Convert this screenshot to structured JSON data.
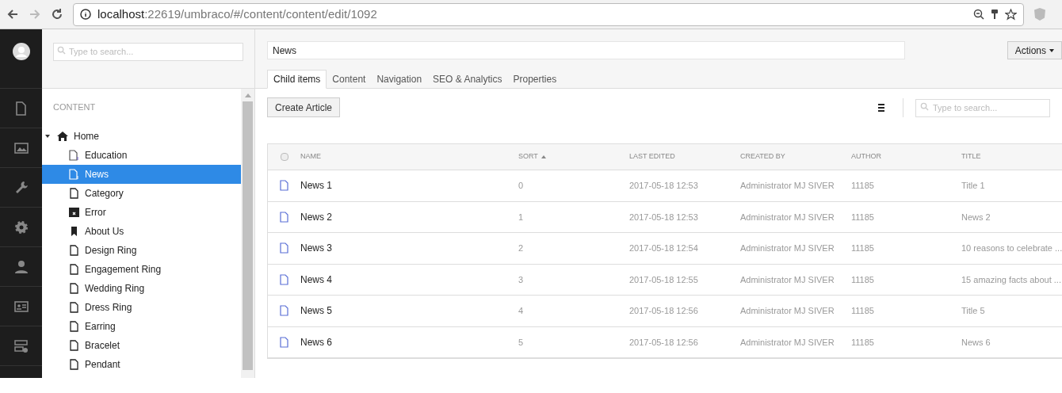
{
  "browser": {
    "url_host": "localhost",
    "url_path": ":22619/umbraco/#/content/content/edit/1092"
  },
  "sections": [
    {
      "kind": "content"
    },
    {
      "kind": "media"
    },
    {
      "kind": "developer"
    },
    {
      "kind": "settings"
    },
    {
      "kind": "users"
    },
    {
      "kind": "members"
    },
    {
      "kind": "forms"
    }
  ],
  "tree": {
    "search_placeholder": "Type to search...",
    "heading": "CONTENT",
    "items": [
      {
        "label": "Home",
        "kind": "home",
        "expanded": true,
        "selected": false,
        "children": [
          {
            "label": "Education",
            "kind": "list",
            "selected": false
          },
          {
            "label": "News",
            "kind": "list",
            "selected": true
          },
          {
            "label": "Category",
            "kind": "doc",
            "selected": false
          },
          {
            "label": "Error",
            "kind": "error",
            "selected": false
          },
          {
            "label": "About Us",
            "kind": "bookmark",
            "selected": false
          },
          {
            "label": "Design Ring",
            "kind": "doc",
            "selected": false
          },
          {
            "label": "Engagement Ring",
            "kind": "doc",
            "selected": false
          },
          {
            "label": "Wedding Ring",
            "kind": "doc",
            "selected": false
          },
          {
            "label": "Dress Ring",
            "kind": "doc",
            "selected": false
          },
          {
            "label": "Earring",
            "kind": "doc",
            "selected": false
          },
          {
            "label": "Bracelet",
            "kind": "doc",
            "selected": false
          },
          {
            "label": "Pendant",
            "kind": "doc",
            "selected": false
          }
        ]
      }
    ]
  },
  "editor": {
    "name": "News",
    "actions": "Actions",
    "tabs": [
      {
        "label": "Child items",
        "selected": true
      },
      {
        "label": "Content",
        "selected": false
      },
      {
        "label": "Navigation",
        "selected": false
      },
      {
        "label": "SEO & Analytics",
        "selected": false
      },
      {
        "label": "Properties",
        "selected": false
      }
    ],
    "create_button": "Create Article",
    "search_placeholder": "Type to search..."
  },
  "table": {
    "select_all_checked": false,
    "columns": [
      {
        "label": "NAME",
        "sorted": false
      },
      {
        "label": "SORT",
        "sorted": true
      },
      {
        "label": "LAST EDITED",
        "sorted": false
      },
      {
        "label": "CREATED BY",
        "sorted": false
      },
      {
        "label": "AUTHOR",
        "sorted": false
      },
      {
        "label": "TITLE",
        "sorted": false
      }
    ],
    "rows": [
      {
        "name": "News 1",
        "sort": "0",
        "last_edited": "2017-05-18 12:53",
        "created_by": "Administrator MJ SIVER",
        "author": "11185",
        "title": "Title 1"
      },
      {
        "name": "News 2",
        "sort": "1",
        "last_edited": "2017-05-18 12:53",
        "created_by": "Administrator MJ SIVER",
        "author": "11185",
        "title": "News 2"
      },
      {
        "name": "News 3",
        "sort": "2",
        "last_edited": "2017-05-18 12:54",
        "created_by": "Administrator MJ SIVER",
        "author": "11185",
        "title": "10 reasons to celebrate ..."
      },
      {
        "name": "News 4",
        "sort": "3",
        "last_edited": "2017-05-18 12:55",
        "created_by": "Administrator MJ SIVER",
        "author": "11185",
        "title": "15 amazing facts about ..."
      },
      {
        "name": "News 5",
        "sort": "4",
        "last_edited": "2017-05-18 12:56",
        "created_by": "Administrator MJ SIVER",
        "author": "11185",
        "title": "Title 5"
      },
      {
        "name": "News 6",
        "sort": "5",
        "last_edited": "2017-05-18 12:56",
        "created_by": "Administrator MJ SIVER",
        "author": "11185",
        "title": "News 6"
      }
    ]
  }
}
